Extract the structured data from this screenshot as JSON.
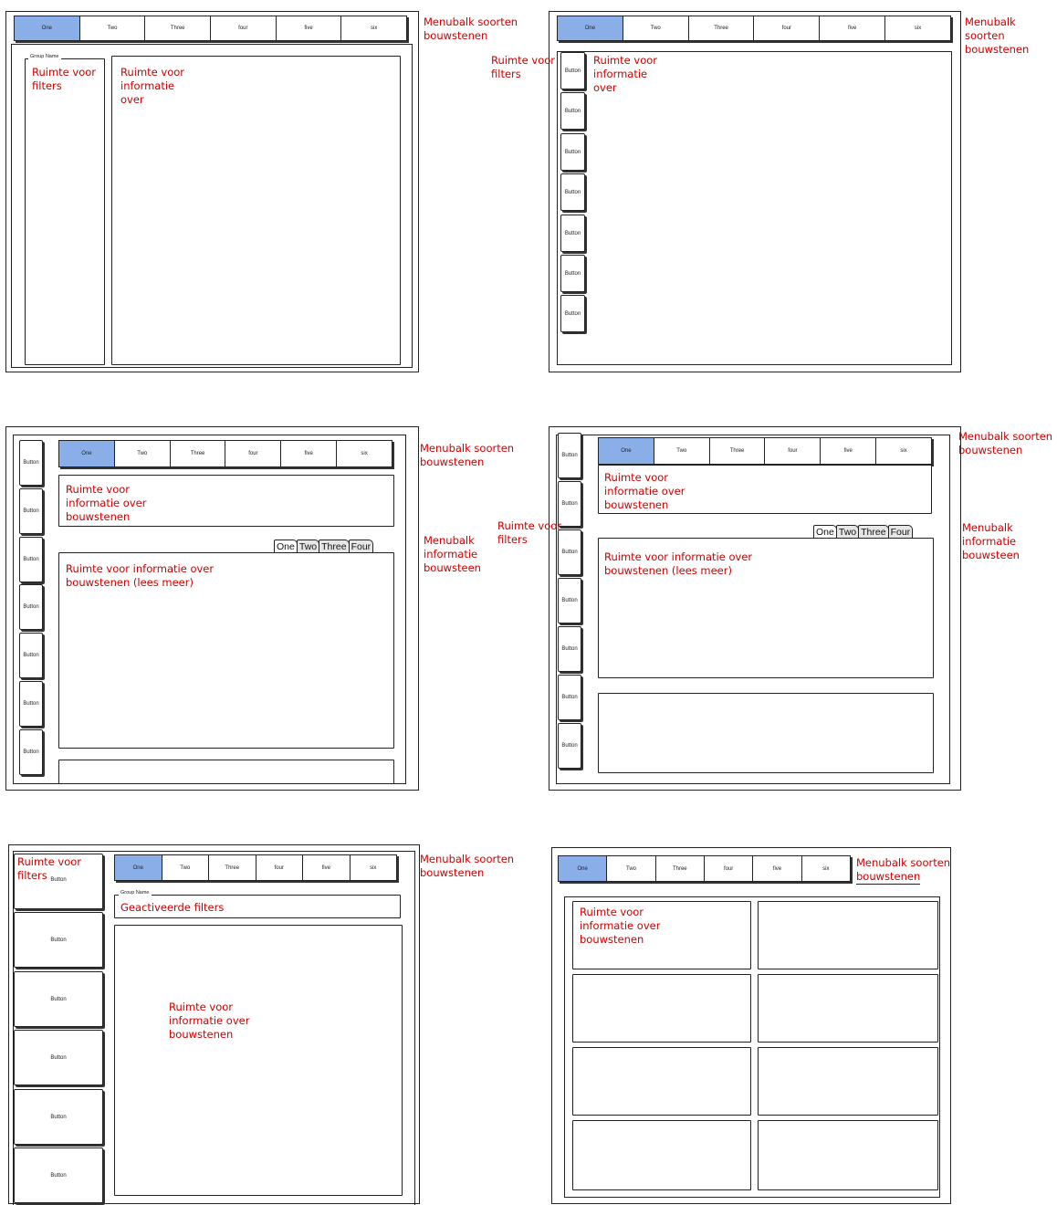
{
  "tabs": [
    "One",
    "Two",
    "Three",
    "four",
    "five",
    "six"
  ],
  "button_label": "Button",
  "group_name": "Group Name",
  "section_tabs": [
    "One",
    "Two",
    "Three",
    "Four"
  ],
  "colors": {
    "annotation": "#cc0000",
    "active_tab": "#8aaee8"
  },
  "notes": {
    "menubalk_soorten": "Menubalk soorten\nbouwstenen",
    "menubalk_soorten_top": "Menubalk soorten",
    "menubalk_soorten_bottom": "bouwstenen",
    "ruimte_filters": "Ruimte voor\nfilters",
    "ruimte_info_over": "Ruimte voor\ninformatie\nover",
    "ruimte_info_bouwstenen": "Ruimte voor\ninformatie over\nbouwstenen",
    "ruimte_info_lees_meer": "Ruimte voor informatie over\nbouwstenen (lees meer)",
    "menubalk_informatie": "Menubalk\ninformatie\nbouwsteen",
    "geactiveerde_filters": "Geactiveerde filters"
  }
}
